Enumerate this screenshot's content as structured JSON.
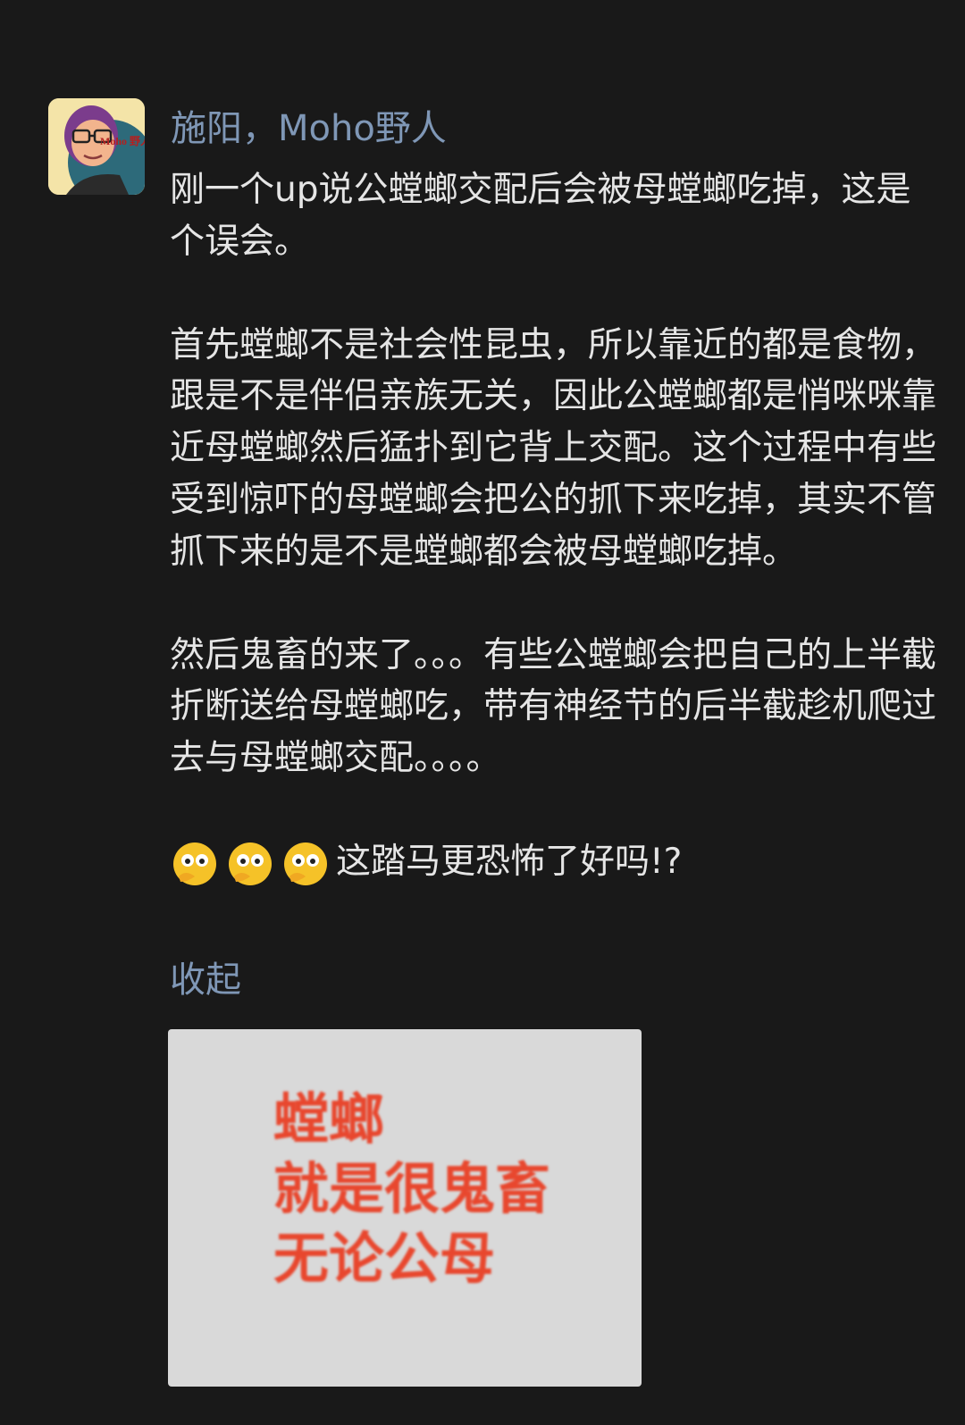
{
  "post": {
    "author": "施阳，Moho野人",
    "avatar_icon": "cartoon-man-avatar-icon",
    "avatar_text": "Moho 野人",
    "paragraphs": [
      "刚一个up说公螳螂交配后会被母螳螂吃掉，这是个误会。",
      "首先螳螂不是社会性昆虫，所以靠近的都是食物，跟是不是伴侣亲族无关，因此公螳螂都是悄咪咪靠近母螳螂然后猛扑到它背上交配。这个过程中有些受到惊吓的母螳螂会把公的抓下来吃掉，其实不管抓下来的是不是螳螂都会被母螳螂吃掉。",
      "然后鬼畜的来了。。。有些公螳螂会把自己的上半截折断送给母螳螂吃，带有神经节的后半截趁机爬过去与母螳螂交配。。。。"
    ],
    "final_line": {
      "emoji": [
        "thinking-face-icon",
        "thinking-face-icon",
        "thinking-face-icon"
      ],
      "text": "这踏马更恐怖了好吗!?"
    },
    "collapse_label": "收起",
    "image": {
      "lines": [
        "螳螂",
        "就是很鬼畜",
        "无论公母"
      ],
      "text_color": "#e8472e",
      "background": "#d9d9d9"
    }
  },
  "colors": {
    "background": "#191919",
    "text": "#e5e5e5",
    "link": "#7f97b6"
  }
}
